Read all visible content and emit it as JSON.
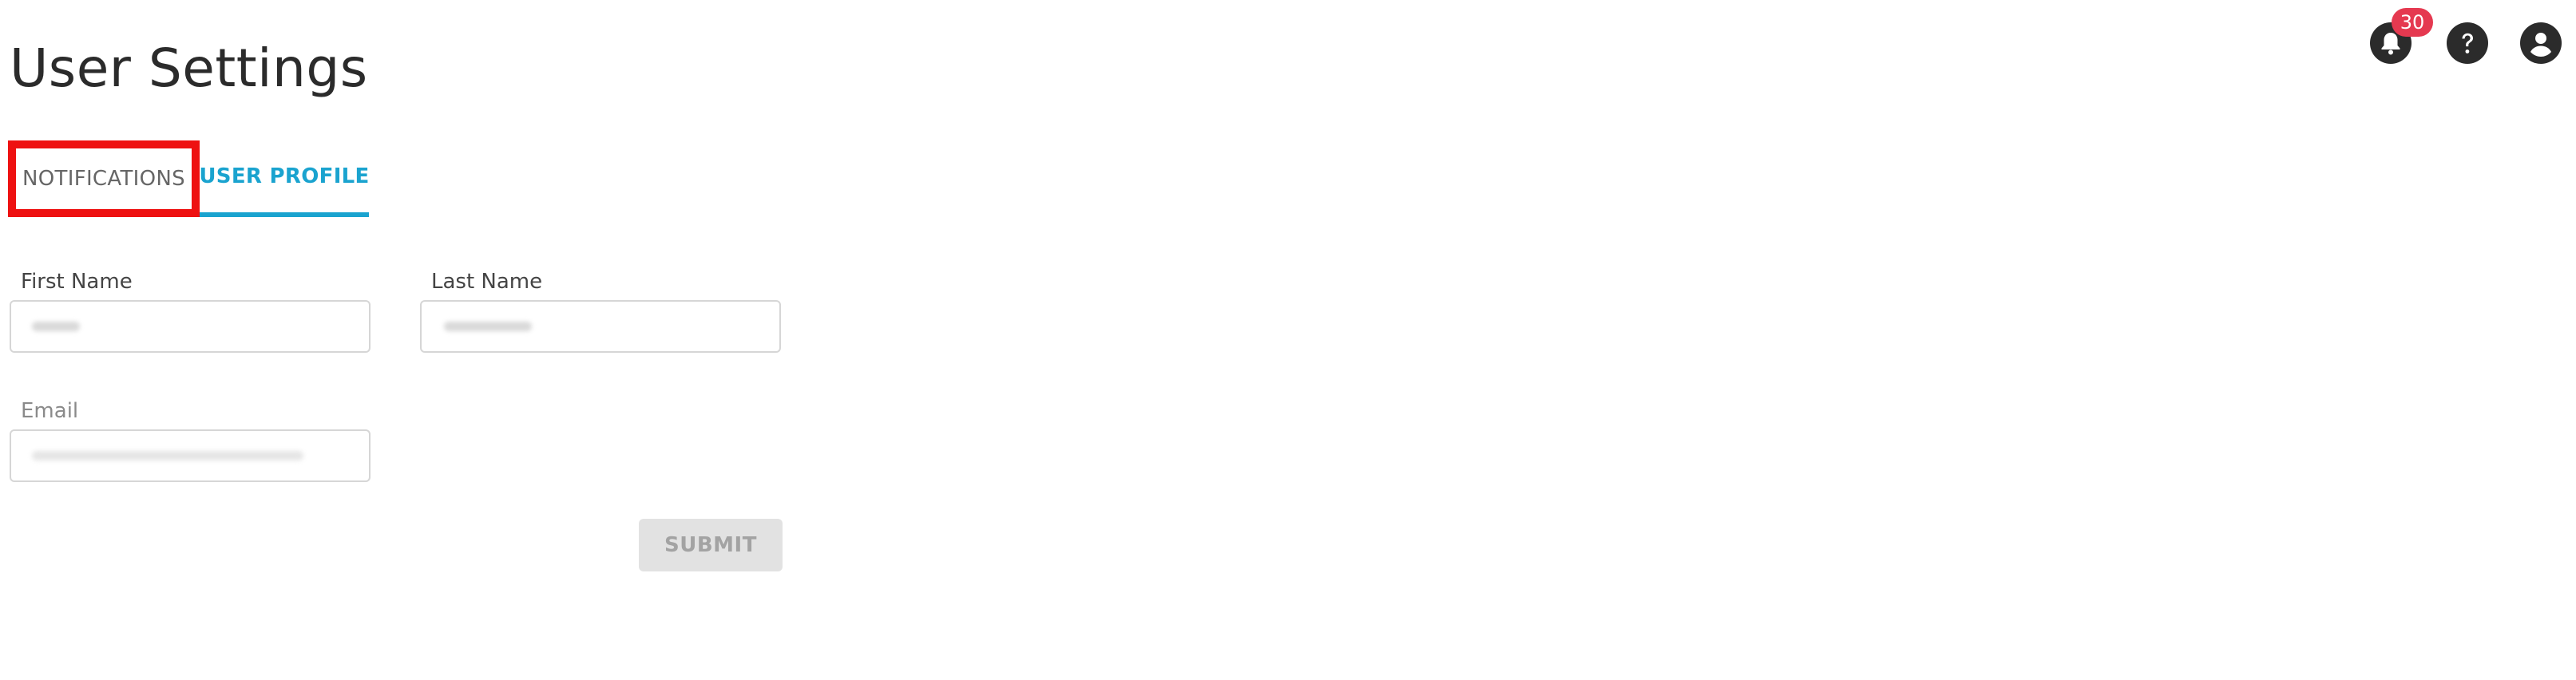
{
  "page": {
    "title": "User Settings"
  },
  "topbar": {
    "notifications_count": "30",
    "icons": [
      "bell-icon",
      "help-icon",
      "account-icon"
    ]
  },
  "tabs": [
    {
      "label": "NOTIFICATIONS",
      "active": false
    },
    {
      "label": "USER PROFILE",
      "active": true
    }
  ],
  "form": {
    "first_name": {
      "label": "First Name",
      "value": ""
    },
    "last_name": {
      "label": "Last Name",
      "value": ""
    },
    "email": {
      "label": "Email",
      "value": ""
    },
    "submit_label": "SUBMIT"
  },
  "colors": {
    "accent": "#1aa3cf",
    "badge": "#e53950",
    "highlight_box": "#ee1111",
    "icon_dark": "#2b2b2b"
  }
}
